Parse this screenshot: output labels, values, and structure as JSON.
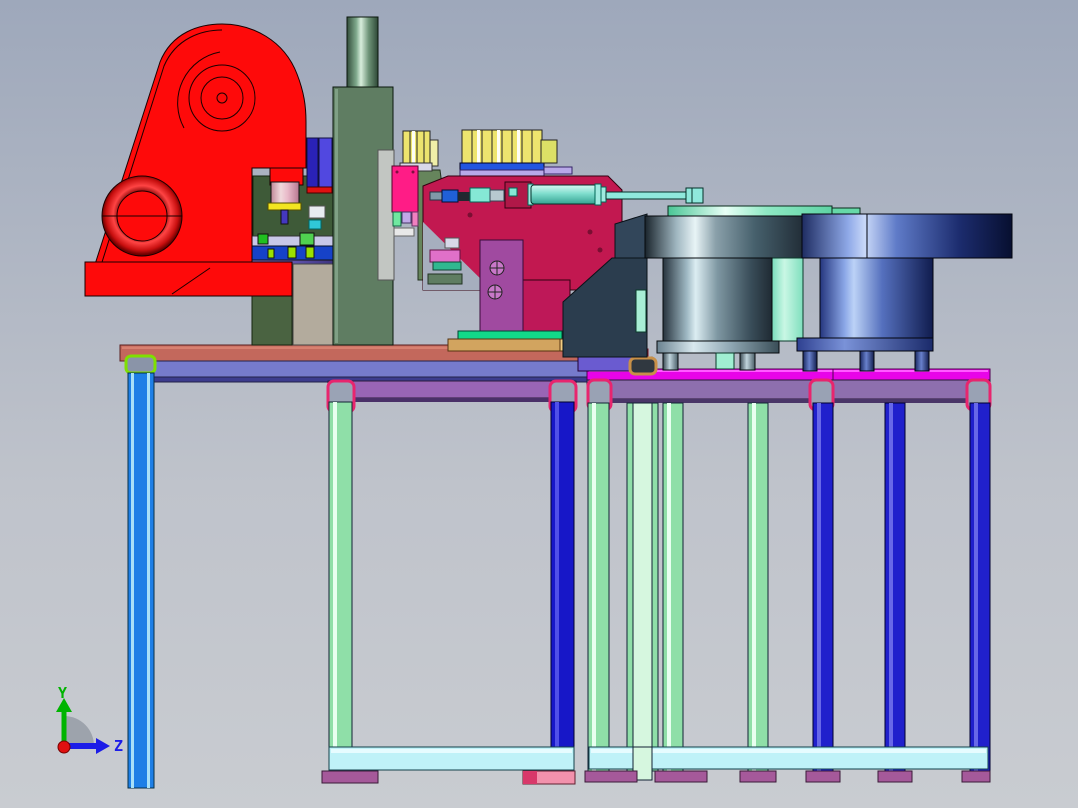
{
  "axis_triad": {
    "labels": {
      "y": "Y",
      "z": "Z"
    },
    "colors": {
      "y": "#00B400",
      "z": "#1C1CE8",
      "origin": "#E01010",
      "wedge": "#8F95A0"
    }
  },
  "palette": {
    "press_red": "#FE0A0A",
    "press_ring_dark": "#8A0000",
    "column_green": "#5F7D62",
    "die_olive": "#3E5A38",
    "support_olive": "#4A6341",
    "block_tan": "#B3AB9D",
    "bolster_blue": "#1642C8",
    "flange_yellow": "#F2E520",
    "pin_violet": "#4438C0",
    "slab_indigo": "#2A22B8",
    "slab_violet": "#5148E0",
    "spring_yellow": "#EDE46E",
    "band_blue": "#2255E0",
    "band_lavender": "#B8A8E8",
    "hot_pink": "#FF1C86",
    "fixture_crimson": "#C21850",
    "orchid": "#A04AA0",
    "cylinder_teal": "#7FDECE",
    "chute_slate": "#2B3D4E",
    "strip_green": "#12D989",
    "plate_sand": "#D2A45F",
    "plate_sand_light": "#F2CD82",
    "block_purple": "#6A5BD0",
    "strip_lavender": "#B088C8",
    "block_rust": "#C05038",
    "clamp_ochre": "#C89048",
    "mint": "#A8EED5",
    "table_top_salmon": "#C3685C",
    "table_band_periwinkle": "#767BCC",
    "table_top_magenta": "#E804E8",
    "table_band_purple": "#8E6FAE",
    "apron_purple": "#9965B5",
    "bracket_pink": "#E8256E",
    "cap_chartreuse": "#7FE000",
    "leg_blue": "#1E7FE6",
    "leg_mint": "#8FDFA8",
    "leg_pale": "#D6F7DF",
    "leg_navy": "#1717C8",
    "leg_royal": "#2020CC",
    "stretcher_cyan": "#BFF2F8",
    "foot_pad_purple": "#A5599A",
    "foot_pad_pink": "#F291AC",
    "background_top": "#9EA8BB",
    "background_bottom": "#C9CCD1"
  }
}
